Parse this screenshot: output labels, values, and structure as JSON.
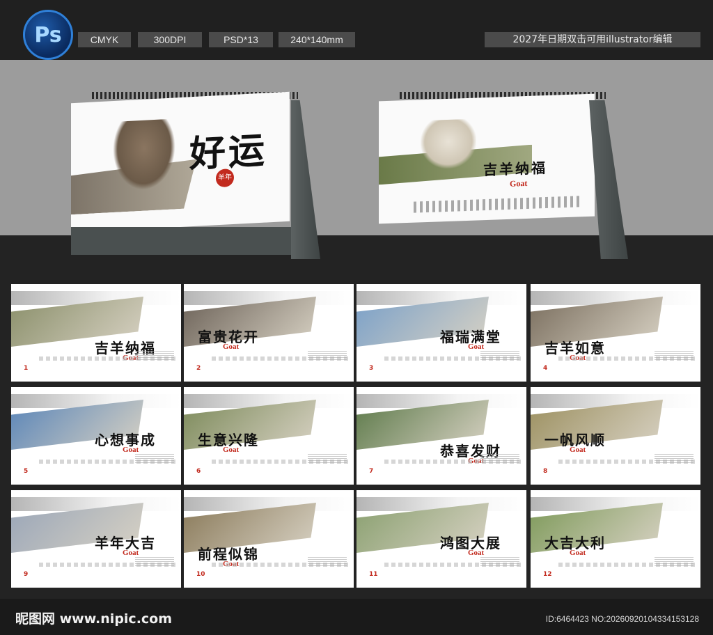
{
  "header": {
    "logo": "Ps",
    "specs": [
      "CMYK",
      "300DPI",
      "PSD*13",
      "240*140mm"
    ],
    "title": "2027年日期双击可用illustrator编辑"
  },
  "hero": {
    "cover_title": "好运",
    "cover_seal": "羊年",
    "front_slogan": "吉羊纳福",
    "front_goat": "Goat"
  },
  "months": [
    {
      "num": "1",
      "slogan": "吉羊纳福",
      "photo": "#8a8f6a"
    },
    {
      "num": "2",
      "slogan": "富贵花开",
      "photo": "#6c6258"
    },
    {
      "num": "3",
      "slogan": "福瑞满堂",
      "photo": "#7aa0c8"
    },
    {
      "num": "4",
      "slogan": "吉羊如意",
      "photo": "#7a6e5e"
    },
    {
      "num": "5",
      "slogan": "心想事成",
      "photo": "#5a85b8"
    },
    {
      "num": "6",
      "slogan": "生意兴隆",
      "photo": "#7c8a5a"
    },
    {
      "num": "7",
      "slogan": "恭喜发财",
      "photo": "#5d7a4a"
    },
    {
      "num": "8",
      "slogan": "一帆风顺",
      "photo": "#9c9060"
    },
    {
      "num": "9",
      "slogan": "羊年大吉",
      "photo": "#9aa6b8"
    },
    {
      "num": "10",
      "slogan": "前程似锦",
      "photo": "#8a7a5a"
    },
    {
      "num": "11",
      "slogan": "鸿图大展",
      "photo": "#8aa070"
    },
    {
      "num": "12",
      "slogan": "大吉大利",
      "photo": "#7e9a5a"
    }
  ],
  "goat_label": "Goat",
  "footer": {
    "site": "昵图网 www.nipic.com",
    "image_id": "ID:6464423 NO:20260920104334153128"
  }
}
